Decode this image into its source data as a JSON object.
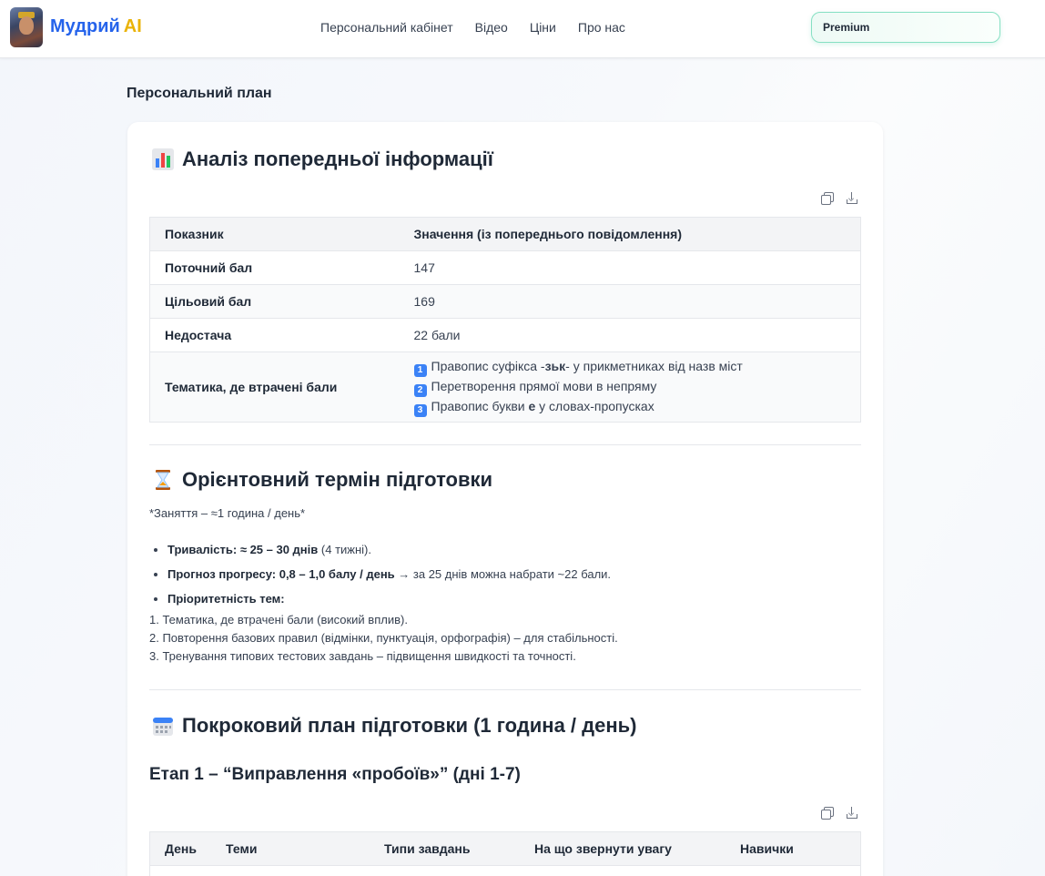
{
  "header": {
    "brand_part1": "Мудрий",
    "brand_part2": "AI",
    "nav": [
      "Персональний кабінет",
      "Відео",
      "Ціни",
      "Про нас"
    ],
    "premium_label": "Premium"
  },
  "page_title": "Персональний план",
  "section1": {
    "emoji": "bar-chart-icon",
    "title": "Аналіз попередньої інформації",
    "table": {
      "headers": [
        "Показник",
        "Значення (із попереднього повідомлення)"
      ],
      "rows": [
        {
          "label": "Поточний бал",
          "value": "147"
        },
        {
          "label": "Цільовий бал",
          "value": "169"
        },
        {
          "label": "Недостача",
          "value": "22 бали"
        }
      ],
      "topics_label": "Тематика, де втрачені бали",
      "topics": [
        {
          "num": "1",
          "pre": "Правопис суфікса -",
          "bold": "зьк",
          "post": "- у прикметниках від назв міст"
        },
        {
          "num": "2",
          "pre": "Перетворення прямої мови в непряму",
          "bold": "",
          "post": ""
        },
        {
          "num": "3",
          "pre": "Правопис букви ",
          "bold": "е",
          "post": " у словах-пропусках"
        }
      ]
    }
  },
  "section2": {
    "emoji": "hourglass-icon",
    "title": "Орієнтовний термін підготовки",
    "note": "*Заняття – ≈1 година / день*",
    "bullets": [
      {
        "bold": "Тривалість: ≈ 25 – 30 днів",
        "rest": " (4 тижні)."
      },
      {
        "bold": "Прогноз прогресу: 0,8 – 1,0 балу / день",
        "rest": " → за 25 днів можна набрати ~22 бали."
      },
      {
        "bold": "Пріоритетність тем:",
        "rest": ""
      }
    ],
    "ordered": [
      "1. Тематика, де втрачені бали (високий вплив).",
      "2. Повторення базових правил (відмінки, пунктуація, орфографія) – для стабільності.",
      "3. Тренування типових тестових завдань – підвищення швидкості та точності."
    ]
  },
  "section3": {
    "emoji": "calendar-icon",
    "title": "Покроковий план підготовки (1 година / день)",
    "stage_title": "Етап 1 – “Виправлення «пробоїв»” (дні 1-7)",
    "table_headers": [
      "День",
      "Теми",
      "Типи завдань",
      "На що звернути увагу",
      "Навички"
    ]
  },
  "colors": {
    "brand_blue": "#2563eb",
    "brand_yellow": "#eab308",
    "premium_border": "#86e0c3",
    "number_badge": "#3b82f6"
  }
}
